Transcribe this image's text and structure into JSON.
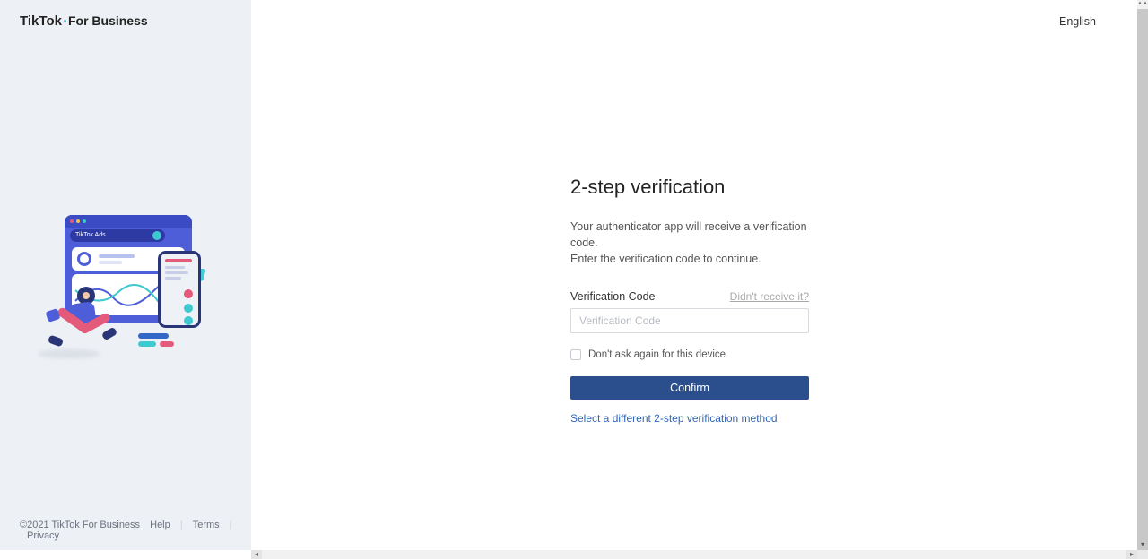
{
  "brand": {
    "name": "TikTok",
    "suffix": "For Business"
  },
  "sidebar_illustration": {
    "badge": "TikTok Ads"
  },
  "footer": {
    "copyright": "©2021 TikTok For Business",
    "links": [
      "Help",
      "Terms",
      "Privacy"
    ]
  },
  "language": "English",
  "form": {
    "title": "2-step verification",
    "description_l1": "Your authenticator app will receive a verification code.",
    "description_l2": "Enter the verification code to continue.",
    "code_label": "Verification Code",
    "didnt_receive": "Didn't receive it?",
    "code_placeholder": "Verification Code",
    "remember_device": "Don't ask again for this device",
    "confirm": "Confirm",
    "alt_method": "Select a different 2-step verification method"
  }
}
